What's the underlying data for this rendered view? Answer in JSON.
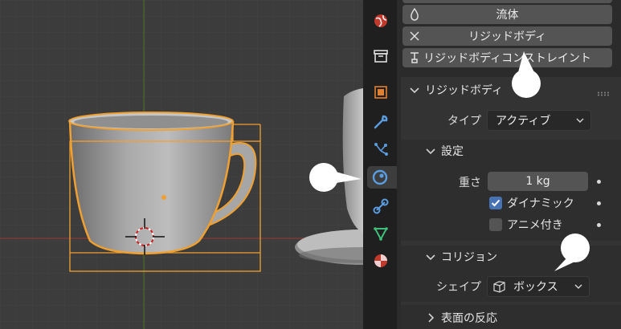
{
  "physics_buttons": {
    "fluid": "流体",
    "rigid_body": "リジッドボディ",
    "rigid_body_constraint": "リジッドボディコンストレイント"
  },
  "rigid_body_panel": {
    "title": "リジッドボディ",
    "type_label": "タイプ",
    "type_value": "アクティブ",
    "settings": {
      "title": "設定",
      "mass_label": "重さ",
      "mass_value": "1 kg",
      "dynamic_label": "ダイナミック",
      "dynamic_checked": true,
      "animated_label": "アニメ付き",
      "animated_checked": false
    },
    "collision": {
      "title": "コリジョン",
      "shape_label": "シェイプ",
      "shape_value": "ボックス"
    },
    "surface_response": {
      "title": "表面の反応"
    }
  },
  "tabs": [
    "world-icon",
    "collection-icon",
    "object-icon",
    "modifier-icon",
    "particles-icon",
    "physics-icon",
    "constraints-icon",
    "data-icon",
    "material-icon"
  ],
  "active_tab": "physics-icon",
  "colors": {
    "selection_outline": "#f0a030",
    "active_tab": "#3d3d3d",
    "checkbox_on": "#4772b3",
    "axis_x": "#8a3a3a",
    "axis_y": "#4a6a2a"
  }
}
